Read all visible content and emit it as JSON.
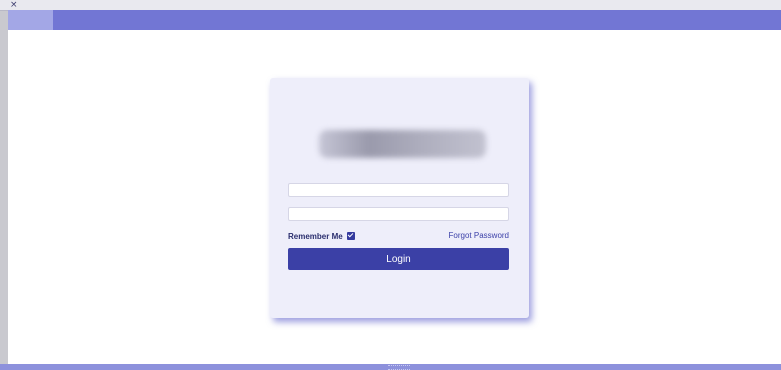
{
  "window": {
    "close_glyph": "×",
    "colors": {
      "titlebar": "#7276d4",
      "titlebar_tab": "#a3a7e6",
      "card_background": "#eeeefa",
      "accent": "#3b40a6"
    }
  },
  "login_form": {
    "logo_icon": "blurred-logo",
    "username": {
      "value": "",
      "placeholder": ""
    },
    "password": {
      "value": "",
      "placeholder": ""
    },
    "remember_me": {
      "label": "Remember Me",
      "checked": true
    },
    "forgot_password_label": "Forgot Password",
    "login_label": "Login"
  }
}
